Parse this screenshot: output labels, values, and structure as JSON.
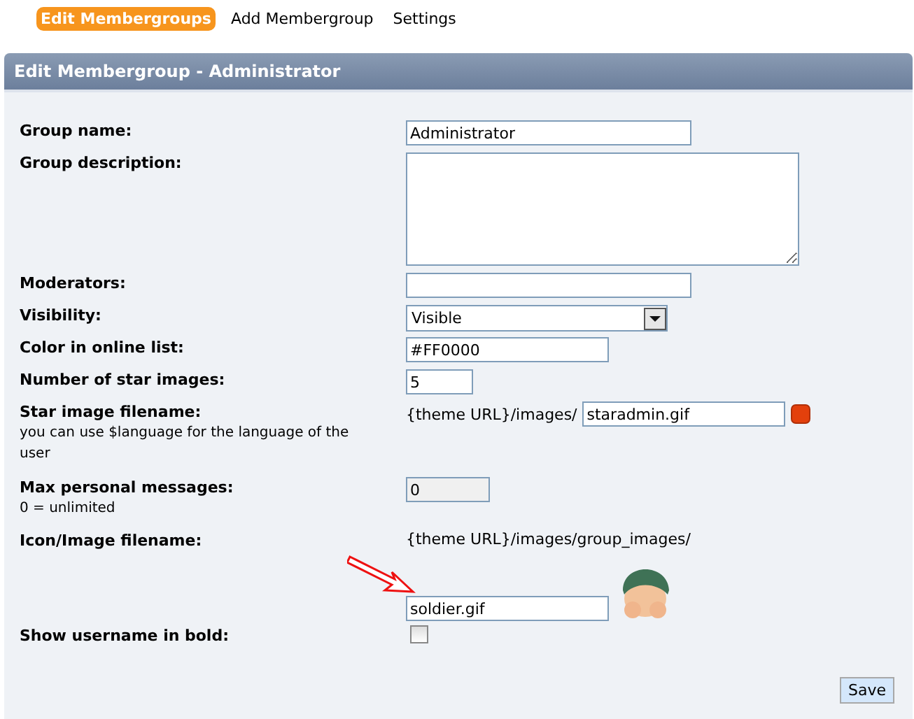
{
  "tabs": [
    {
      "label": "Edit Membergroups",
      "selected": true
    },
    {
      "label": "Add Membergroup",
      "selected": false
    },
    {
      "label": "Settings",
      "selected": false
    }
  ],
  "panel": {
    "title": "Edit Membergroup - Administrator"
  },
  "rows": [
    {
      "kind": "text",
      "label": "Group name:",
      "value": "Administrator"
    },
    {
      "kind": "textarea",
      "label": "Group description:"
    },
    {
      "kind": "text",
      "label": "Moderators:"
    },
    {
      "kind": "select",
      "label": "Visibility:",
      "value": "Visible"
    },
    {
      "kind": "short",
      "label": "Color in online list:",
      "value": "#FF0000"
    },
    {
      "kind": "tiny",
      "label": "Number of star images:",
      "value": "5"
    },
    {
      "kind": "star",
      "label": "Star image filename:",
      "note": "you can use $language for the language of the user",
      "prefix": "{theme URL}/images/",
      "value": "staradmin.gif"
    },
    {
      "kind": "readonly",
      "label": "Max personal messages:",
      "note": "0 = unlimited",
      "value": "0"
    },
    {
      "kind": "image",
      "label": "Icon/Image filename:",
      "prefix": "{theme URL}/images/group_images/",
      "value": "soldier.gif"
    },
    {
      "kind": "checkbox",
      "label": "Show username in bold:",
      "checked": false
    }
  ],
  "save_button": "Save"
}
